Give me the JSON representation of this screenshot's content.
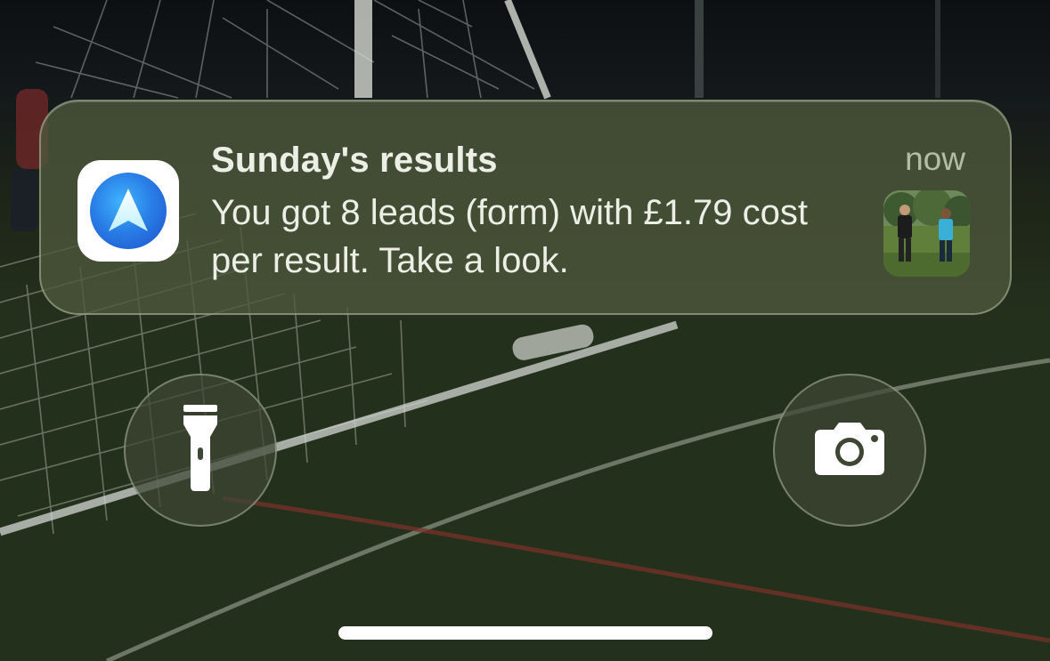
{
  "notification": {
    "app_icon": "navigation-arrow-app-icon",
    "title": "Sunday's results",
    "time": "now",
    "body": "You got 8 leads (form) with £1.79 cost per result. Take a look.",
    "thumbnail": "photo-thumbnail"
  },
  "quick_actions": {
    "flashlight_icon": "flashlight-icon",
    "camera_icon": "camera-icon"
  },
  "colors": {
    "notification_bg": "#4e583c",
    "app_icon_blue": "#2a7fe6",
    "text": "#ecefe6"
  }
}
